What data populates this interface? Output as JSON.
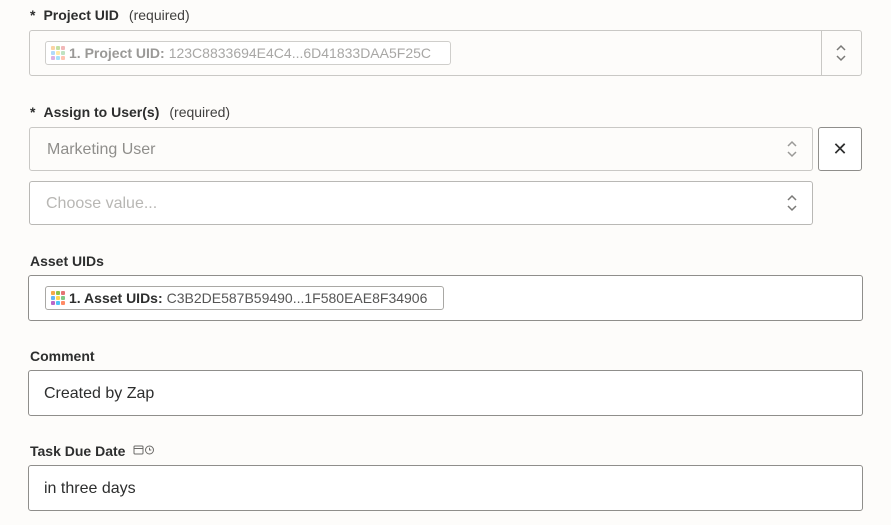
{
  "fields": {
    "project_uid": {
      "star": "*",
      "label": "Project UID",
      "required": "(required)",
      "pill_key": "1. Project UID:",
      "pill_value": "123C8833694E4C4...6D41833DAA5F25C",
      "icon": "chevron-up-down-icon"
    },
    "assign_users": {
      "star": "*",
      "label": "Assign to User(s)",
      "required": "(required)",
      "selected": "Marketing User",
      "second_placeholder": "Choose value...",
      "remove_symbol": "✕",
      "icon": "chevron-up-down-icon"
    },
    "asset_uids": {
      "label": "Asset UIDs",
      "pill_key": "1. Asset UIDs:",
      "pill_value": "C3B2DE587B59490...1F580EAE8F34906"
    },
    "comment": {
      "label": "Comment",
      "value": "Created by Zap"
    },
    "task_due_date": {
      "label": "Task Due Date",
      "icon": "calendar-clock-icon",
      "value": "in three days"
    }
  },
  "colors": {
    "background": "#fdfcfa",
    "border": "#b9b8b5",
    "text": "#2d2e2e",
    "placeholder": "#8f8e8b"
  },
  "app_icon_colors": [
    "#f6a84b",
    "#8bc34a",
    "#e57373",
    "#64b5f6",
    "#ffd54f",
    "#81c784",
    "#ba68c8",
    "#4fc3f7",
    "#ff8a65"
  ]
}
